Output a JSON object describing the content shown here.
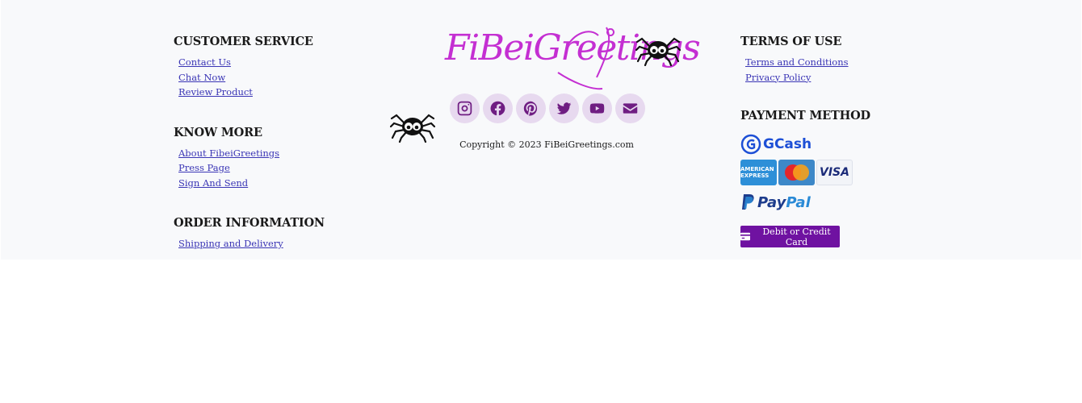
{
  "footer": {
    "customer_service": {
      "heading": "CUSTOMER SERVICE",
      "links": [
        "Contact Us",
        "Chat Now",
        "Review Product"
      ]
    },
    "know_more": {
      "heading": "KNOW MORE",
      "links": [
        "About FibeiGreetings",
        "Press Page",
        "Sign And Send"
      ]
    },
    "order_information": {
      "heading": "ORDER INFORMATION",
      "links": [
        "Shipping and Delivery"
      ]
    },
    "brand": {
      "logo_text": "FiBeiGreetings",
      "logo_color": "#c42fd2"
    },
    "social": {
      "icons": [
        "instagram-icon",
        "facebook-icon",
        "pinterest-icon",
        "twitter-icon",
        "youtube-icon",
        "envelope-icon"
      ],
      "icon_color": "#6f1d82",
      "bubble_color": "#e7d9ef"
    },
    "copyright": "Copyright © 2023 FiBeiGreetings.com",
    "terms": {
      "heading": "TERMS OF USE",
      "links": [
        "Terms and Conditions",
        "Privacy Policy"
      ]
    },
    "payment": {
      "heading": "PAYMENT METHOD",
      "gcash": "GCash",
      "cards": [
        "AMERICAN EXPRESS",
        "MasterCard",
        "VISA"
      ],
      "paypal_pay": "Pay",
      "paypal_pal": "Pal",
      "debit_label": "Debit or Credit Card",
      "button_color": "#6f12a1"
    }
  }
}
